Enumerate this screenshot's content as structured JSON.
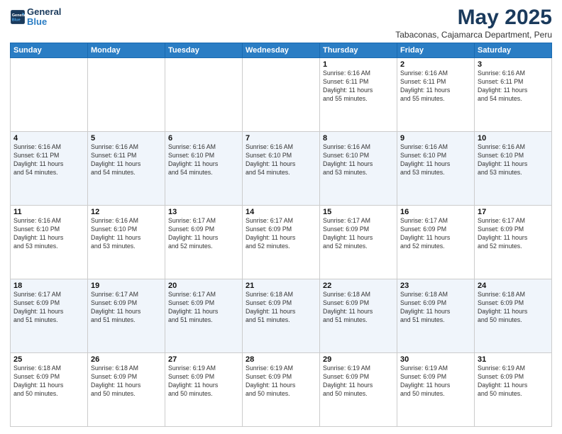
{
  "logo": {
    "line1": "General",
    "line2": "Blue"
  },
  "title": "May 2025",
  "subtitle": "Tabaconas, Cajamarca Department, Peru",
  "days_of_week": [
    "Sunday",
    "Monday",
    "Tuesday",
    "Wednesday",
    "Thursday",
    "Friday",
    "Saturday"
  ],
  "weeks": [
    [
      {
        "day": "",
        "info": ""
      },
      {
        "day": "",
        "info": ""
      },
      {
        "day": "",
        "info": ""
      },
      {
        "day": "",
        "info": ""
      },
      {
        "day": "1",
        "info": "Sunrise: 6:16 AM\nSunset: 6:11 PM\nDaylight: 11 hours\nand 55 minutes."
      },
      {
        "day": "2",
        "info": "Sunrise: 6:16 AM\nSunset: 6:11 PM\nDaylight: 11 hours\nand 55 minutes."
      },
      {
        "day": "3",
        "info": "Sunrise: 6:16 AM\nSunset: 6:11 PM\nDaylight: 11 hours\nand 54 minutes."
      }
    ],
    [
      {
        "day": "4",
        "info": "Sunrise: 6:16 AM\nSunset: 6:11 PM\nDaylight: 11 hours\nand 54 minutes."
      },
      {
        "day": "5",
        "info": "Sunrise: 6:16 AM\nSunset: 6:11 PM\nDaylight: 11 hours\nand 54 minutes."
      },
      {
        "day": "6",
        "info": "Sunrise: 6:16 AM\nSunset: 6:10 PM\nDaylight: 11 hours\nand 54 minutes."
      },
      {
        "day": "7",
        "info": "Sunrise: 6:16 AM\nSunset: 6:10 PM\nDaylight: 11 hours\nand 54 minutes."
      },
      {
        "day": "8",
        "info": "Sunrise: 6:16 AM\nSunset: 6:10 PM\nDaylight: 11 hours\nand 53 minutes."
      },
      {
        "day": "9",
        "info": "Sunrise: 6:16 AM\nSunset: 6:10 PM\nDaylight: 11 hours\nand 53 minutes."
      },
      {
        "day": "10",
        "info": "Sunrise: 6:16 AM\nSunset: 6:10 PM\nDaylight: 11 hours\nand 53 minutes."
      }
    ],
    [
      {
        "day": "11",
        "info": "Sunrise: 6:16 AM\nSunset: 6:10 PM\nDaylight: 11 hours\nand 53 minutes."
      },
      {
        "day": "12",
        "info": "Sunrise: 6:16 AM\nSunset: 6:10 PM\nDaylight: 11 hours\nand 53 minutes."
      },
      {
        "day": "13",
        "info": "Sunrise: 6:17 AM\nSunset: 6:09 PM\nDaylight: 11 hours\nand 52 minutes."
      },
      {
        "day": "14",
        "info": "Sunrise: 6:17 AM\nSunset: 6:09 PM\nDaylight: 11 hours\nand 52 minutes."
      },
      {
        "day": "15",
        "info": "Sunrise: 6:17 AM\nSunset: 6:09 PM\nDaylight: 11 hours\nand 52 minutes."
      },
      {
        "day": "16",
        "info": "Sunrise: 6:17 AM\nSunset: 6:09 PM\nDaylight: 11 hours\nand 52 minutes."
      },
      {
        "day": "17",
        "info": "Sunrise: 6:17 AM\nSunset: 6:09 PM\nDaylight: 11 hours\nand 52 minutes."
      }
    ],
    [
      {
        "day": "18",
        "info": "Sunrise: 6:17 AM\nSunset: 6:09 PM\nDaylight: 11 hours\nand 51 minutes."
      },
      {
        "day": "19",
        "info": "Sunrise: 6:17 AM\nSunset: 6:09 PM\nDaylight: 11 hours\nand 51 minutes."
      },
      {
        "day": "20",
        "info": "Sunrise: 6:17 AM\nSunset: 6:09 PM\nDaylight: 11 hours\nand 51 minutes."
      },
      {
        "day": "21",
        "info": "Sunrise: 6:18 AM\nSunset: 6:09 PM\nDaylight: 11 hours\nand 51 minutes."
      },
      {
        "day": "22",
        "info": "Sunrise: 6:18 AM\nSunset: 6:09 PM\nDaylight: 11 hours\nand 51 minutes."
      },
      {
        "day": "23",
        "info": "Sunrise: 6:18 AM\nSunset: 6:09 PM\nDaylight: 11 hours\nand 51 minutes."
      },
      {
        "day": "24",
        "info": "Sunrise: 6:18 AM\nSunset: 6:09 PM\nDaylight: 11 hours\nand 50 minutes."
      }
    ],
    [
      {
        "day": "25",
        "info": "Sunrise: 6:18 AM\nSunset: 6:09 PM\nDaylight: 11 hours\nand 50 minutes."
      },
      {
        "day": "26",
        "info": "Sunrise: 6:18 AM\nSunset: 6:09 PM\nDaylight: 11 hours\nand 50 minutes."
      },
      {
        "day": "27",
        "info": "Sunrise: 6:19 AM\nSunset: 6:09 PM\nDaylight: 11 hours\nand 50 minutes."
      },
      {
        "day": "28",
        "info": "Sunrise: 6:19 AM\nSunset: 6:09 PM\nDaylight: 11 hours\nand 50 minutes."
      },
      {
        "day": "29",
        "info": "Sunrise: 6:19 AM\nSunset: 6:09 PM\nDaylight: 11 hours\nand 50 minutes."
      },
      {
        "day": "30",
        "info": "Sunrise: 6:19 AM\nSunset: 6:09 PM\nDaylight: 11 hours\nand 50 minutes."
      },
      {
        "day": "31",
        "info": "Sunrise: 6:19 AM\nSunset: 6:09 PM\nDaylight: 11 hours\nand 50 minutes."
      }
    ]
  ]
}
